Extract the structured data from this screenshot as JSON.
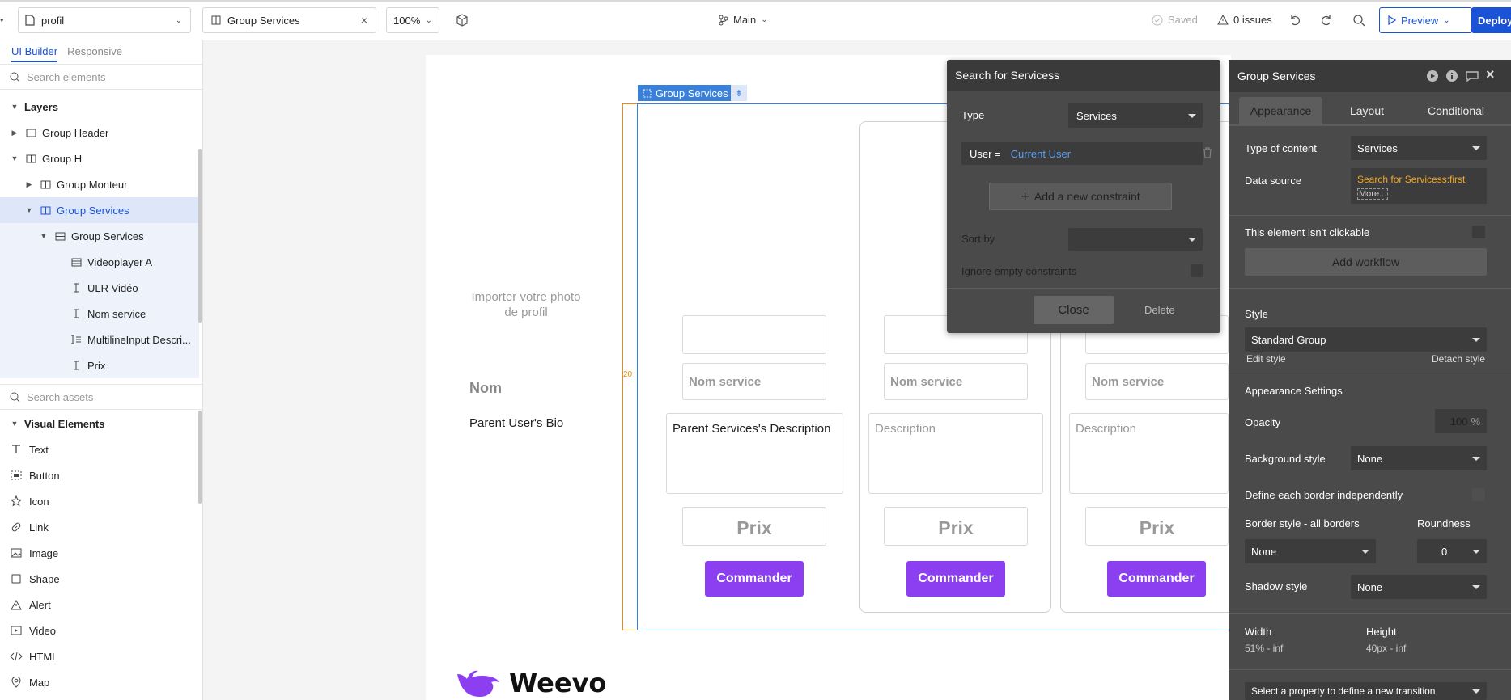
{
  "topbar": {
    "page_select": "profil",
    "element_tab": "Group Services",
    "zoom": "100%",
    "branch": "Main",
    "saved": "Saved",
    "issues": "0 issues",
    "preview": "Preview",
    "deploy": "Deploy"
  },
  "left": {
    "tab_builder": "UI Builder",
    "tab_responsive": "Responsive",
    "search_elements": "Search elements",
    "layers_title": "Layers",
    "layers": [
      {
        "label": "Group Header"
      },
      {
        "label": "Group H"
      },
      {
        "label": "Group Monteur"
      },
      {
        "label": "Group Services"
      },
      {
        "label": "Group Services"
      },
      {
        "label": "Videoplayer A"
      },
      {
        "label": "ULR Vidéo"
      },
      {
        "label": "Nom service"
      },
      {
        "label": "MultilineInput Descri..."
      },
      {
        "label": "Prix"
      }
    ],
    "search_assets": "Search assets",
    "visual_title": "Visual Elements",
    "visual": [
      "Text",
      "Button",
      "Icon",
      "Link",
      "Image",
      "Shape",
      "Alert",
      "Video",
      "HTML",
      "Map"
    ]
  },
  "canvas": {
    "group_tag": "Group Services",
    "import_photo": "Importer votre photo de profil",
    "nom": "Nom",
    "bio": "Parent User's Bio",
    "padding_label": "20",
    "card1": {
      "nom": "Nom service",
      "desc": "Parent Services's Description",
      "prix": "Prix",
      "cmd": "Commander"
    },
    "card2": {
      "nom": "Nom service",
      "desc": "Description",
      "prix": "Prix",
      "cmd": "Commander"
    },
    "card3": {
      "nom": "Nom service",
      "desc": "Description",
      "prix": "Prix",
      "cmd": "Commander"
    },
    "logo": "Weevo"
  },
  "search_popup": {
    "title": "Search for Servicess",
    "type_label": "Type",
    "type_value": "Services",
    "constraint_key": "User =",
    "constraint_value": "Current User",
    "add_constraint": "Add a new constraint",
    "sort_label": "Sort by",
    "ignore_label": "Ignore empty constraints",
    "close": "Close",
    "delete": "Delete"
  },
  "props": {
    "title": "Group Services",
    "tabs": [
      "Appearance",
      "Layout",
      "Conditional"
    ],
    "type_label": "Type of content",
    "type_value": "Services",
    "ds_label": "Data source",
    "ds_value": "Search for Servicess:first item",
    "ds_more": "More...",
    "not_clickable": "This element isn't clickable",
    "add_workflow": "Add workflow",
    "style_label": "Style",
    "style_value": "Standard Group",
    "edit_style": "Edit style",
    "detach_style": "Detach style",
    "appearance_settings": "Appearance Settings",
    "opacity_label": "Opacity",
    "opacity_value": "100",
    "opacity_unit": "%",
    "bg_label": "Background style",
    "bg_value": "None",
    "border_indep": "Define each border independently",
    "border_label": "Border style - all borders",
    "roundness_label": "Roundness",
    "border_value": "None",
    "roundness_value": "0",
    "shadow_label": "Shadow style",
    "shadow_value": "None",
    "width_label": "Width",
    "width_value": "51% - inf",
    "height_label": "Height",
    "height_value": "40px - inf",
    "transition": "Select a property to define a new transition"
  },
  "colors": {
    "accent": "#1a53d6",
    "purple": "#8b3ff0",
    "panel": "#4a4a4a",
    "link": "#5aa0f2",
    "orange": "#f5a623"
  }
}
